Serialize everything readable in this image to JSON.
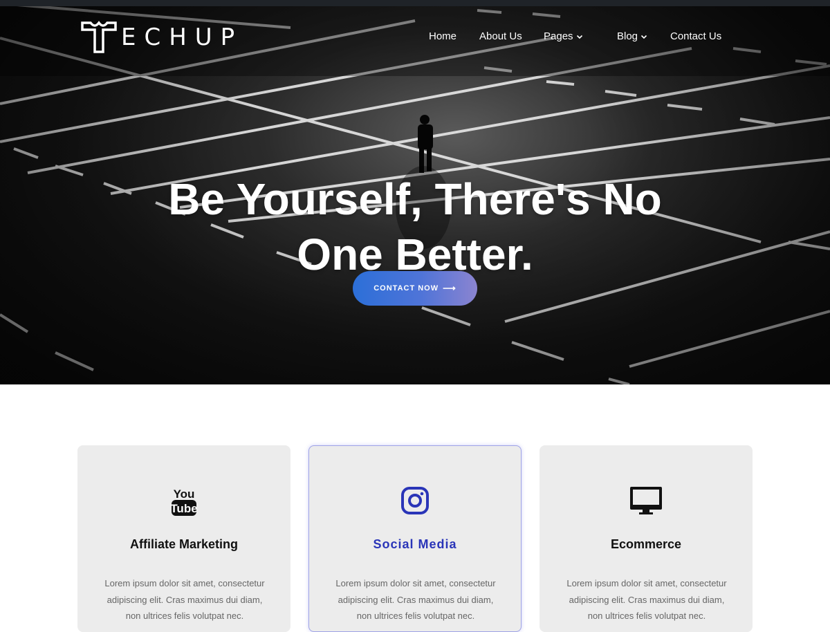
{
  "brand": {
    "logo_text": "ECHUP"
  },
  "nav": {
    "items": [
      {
        "label": "Home",
        "has_dropdown": false
      },
      {
        "label": "About Us",
        "has_dropdown": false
      },
      {
        "label": "Pages",
        "has_dropdown": true
      },
      {
        "label": "Blog",
        "has_dropdown": true
      },
      {
        "label": "Contact Us",
        "has_dropdown": false
      }
    ]
  },
  "hero": {
    "title_line1": "Be Yourself, There's No",
    "title_line2": "One Better.",
    "cta_label": "CONTACT NOW",
    "cta_icon": "arrow-right-icon"
  },
  "features": [
    {
      "icon": "youtube-icon",
      "title": "Affiliate Marketing",
      "text": "Lorem ipsum dolor sit amet, consectetur adipiscing elit. Cras maximus dui diam, non ultrices felis volutpat nec.",
      "active": false
    },
    {
      "icon": "instagram-icon",
      "title": "Social Media",
      "text": "Lorem ipsum dolor sit amet, consectetur adipiscing elit. Cras maximus dui diam, non ultrices felis volutpat nec.",
      "active": true
    },
    {
      "icon": "monitor-icon",
      "title": "Ecommerce",
      "text": "Lorem ipsum dolor sit amet, consectetur adipiscing elit. Cras maximus dui diam, non ultrices felis volutpat nec.",
      "active": false
    }
  ],
  "colors": {
    "accent": "#2a35b8",
    "cta_gradient_start": "#2c6fd8",
    "cta_gradient_end": "#8b84d0",
    "card_background": "#ececec"
  }
}
